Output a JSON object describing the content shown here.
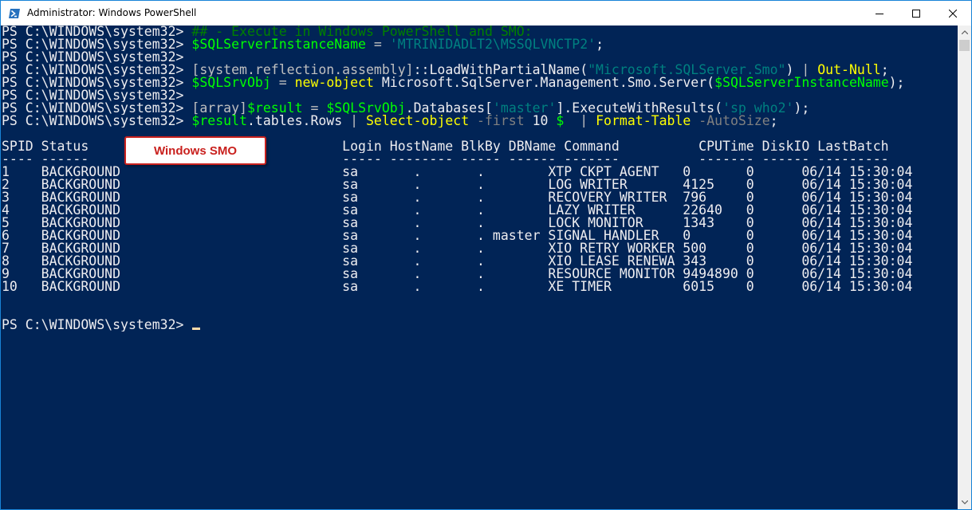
{
  "window": {
    "title": "Administrator: Windows PowerShell",
    "icon": "powershell-icon"
  },
  "colors": {
    "console_bg": "#012456",
    "default_text": "#eeedf0",
    "comment": "#008000",
    "variable": "#00ff00",
    "string": "#008080",
    "command": "#ffff00",
    "type": "#c0c0c0",
    "parameter": "#808080",
    "cursor": "#fedba9",
    "callout_border": "#c9211e"
  },
  "console": {
    "lines": [
      [
        {
          "t": "PS C:\\WINDOWS\\system32> ",
          "c": "default"
        },
        {
          "t": "## - Execute in Windows PowerShell and SMO:",
          "c": "comment"
        }
      ],
      [
        {
          "t": "PS C:\\WINDOWS\\system32> ",
          "c": "default"
        },
        {
          "t": "$SQLServerInstanceName",
          "c": "variable"
        },
        {
          "t": " = ",
          "c": "type"
        },
        {
          "t": "'MTRINIDADLT2\\MSSQLVNCTP2'",
          "c": "string"
        },
        {
          "t": ";",
          "c": "default"
        }
      ],
      [
        {
          "t": "PS C:\\WINDOWS\\system32>",
          "c": "default"
        }
      ],
      [
        {
          "t": "PS C:\\WINDOWS\\system32> ",
          "c": "default"
        },
        {
          "t": "[system.reflection.assembly]",
          "c": "type"
        },
        {
          "t": "::LoadWithPartialName(",
          "c": "default"
        },
        {
          "t": "\"Microsoft.SQLServer.Smo\"",
          "c": "string"
        },
        {
          "t": ") ",
          "c": "default"
        },
        {
          "t": "|",
          "c": "type"
        },
        {
          "t": " ",
          "c": "default"
        },
        {
          "t": "Out-Null",
          "c": "command"
        },
        {
          "t": ";",
          "c": "default"
        }
      ],
      [
        {
          "t": "PS C:\\WINDOWS\\system32> ",
          "c": "default"
        },
        {
          "t": "$SQLSrvObj",
          "c": "variable"
        },
        {
          "t": " = ",
          "c": "type"
        },
        {
          "t": "new-object",
          "c": "command"
        },
        {
          "t": " Microsoft.SqlServer.Management.Smo.Server(",
          "c": "default"
        },
        {
          "t": "$SQLServerInstanceName",
          "c": "variable"
        },
        {
          "t": ");",
          "c": "default"
        }
      ],
      [
        {
          "t": "PS C:\\WINDOWS\\system32>",
          "c": "default"
        }
      ],
      [
        {
          "t": "PS C:\\WINDOWS\\system32> ",
          "c": "default"
        },
        {
          "t": "[array]",
          "c": "type"
        },
        {
          "t": "$result",
          "c": "variable"
        },
        {
          "t": " = ",
          "c": "type"
        },
        {
          "t": "$SQLSrvObj",
          "c": "variable"
        },
        {
          "t": ".Databases[",
          "c": "default"
        },
        {
          "t": "'master'",
          "c": "string"
        },
        {
          "t": "].ExecuteWithResults(",
          "c": "default"
        },
        {
          "t": "'sp_who2'",
          "c": "string"
        },
        {
          "t": ");",
          "c": "default"
        }
      ],
      [
        {
          "t": "PS C:\\WINDOWS\\system32> ",
          "c": "default"
        },
        {
          "t": "$result",
          "c": "variable"
        },
        {
          "t": ".tables.Rows ",
          "c": "default"
        },
        {
          "t": "|",
          "c": "type"
        },
        {
          "t": " ",
          "c": "default"
        },
        {
          "t": "Select-object",
          "c": "command"
        },
        {
          "t": " -first",
          "c": "parameter"
        },
        {
          "t": " 10 ",
          "c": "default"
        },
        {
          "t": "$_",
          "c": "variable"
        },
        {
          "t": " ",
          "c": "default"
        },
        {
          "t": "|",
          "c": "type"
        },
        {
          "t": " ",
          "c": "default"
        },
        {
          "t": "Format-Table",
          "c": "command"
        },
        {
          "t": " -AutoSize",
          "c": "parameter"
        },
        {
          "t": ";",
          "c": "default"
        }
      ],
      [
        {
          "t": "",
          "c": "default"
        }
      ],
      [
        {
          "t": "SPID Status                                Login HostName BlkBy DBName Command          CPUTime DiskIO LastBatch",
          "c": "default"
        }
      ],
      [
        {
          "t": "---- ------                                ----- -------- ----- ------ -------          ------- ------ ---------",
          "c": "default"
        }
      ],
      [
        {
          "t": "1    BACKGROUND                            sa       .       .        XTP_CKPT_AGENT   0       0      06/14 15:30:04",
          "c": "default"
        }
      ],
      [
        {
          "t": "2    BACKGROUND                            sa       .       .        LOG WRITER       4125    0      06/14 15:30:04",
          "c": "default"
        }
      ],
      [
        {
          "t": "3    BACKGROUND                            sa       .       .        RECOVERY WRITER  796     0      06/14 15:30:04",
          "c": "default"
        }
      ],
      [
        {
          "t": "4    BACKGROUND                            sa       .       .        LAZY WRITER      22640   0      06/14 15:30:04",
          "c": "default"
        }
      ],
      [
        {
          "t": "5    BACKGROUND                            sa       .       .        LOCK MONITOR     1343    0      06/14 15:30:04",
          "c": "default"
        }
      ],
      [
        {
          "t": "6    BACKGROUND                            sa       .       . master SIGNAL HANDLER   0       0      06/14 15:30:04",
          "c": "default"
        }
      ],
      [
        {
          "t": "7    BACKGROUND                            sa       .       .        XIO_RETRY_WORKER 500     0      06/14 15:30:04",
          "c": "default"
        }
      ],
      [
        {
          "t": "8    BACKGROUND                            sa       .       .        XIO_LEASE_RENEWA 343     0      06/14 15:30:04",
          "c": "default"
        }
      ],
      [
        {
          "t": "9    BACKGROUND                            sa       .       .        RESOURCE MONITOR 9494890 0      06/14 15:30:04",
          "c": "default"
        }
      ],
      [
        {
          "t": "10   BACKGROUND                            sa       .       .        XE TIMER         6015    0      06/14 15:30:04",
          "c": "default"
        }
      ],
      [
        {
          "t": "",
          "c": "default"
        }
      ],
      [
        {
          "t": "",
          "c": "default"
        }
      ],
      [
        {
          "t": "PS C:\\WINDOWS\\system32> ",
          "c": "default"
        },
        {
          "t": "",
          "c": "cursor"
        }
      ]
    ]
  },
  "callout": {
    "label": "Windows SMO"
  }
}
